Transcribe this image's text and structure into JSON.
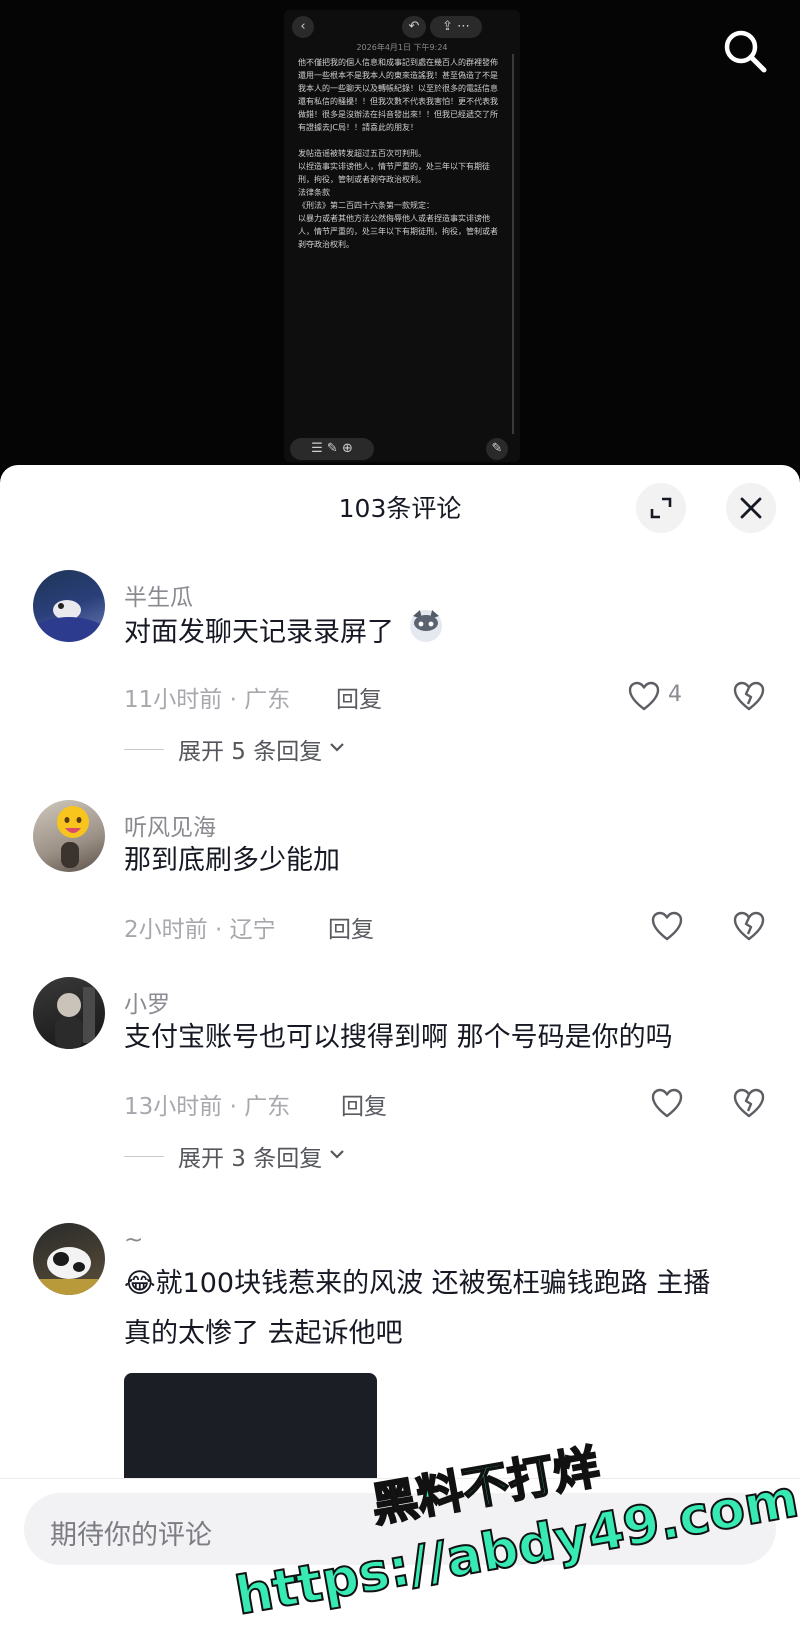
{
  "video": {
    "screenshot_date": "2026年4月1日 下午9:24",
    "screenshot_text": "他不僅把我的個人信息和成事記到處在幾百人的群裡發佈 還用一些根本不是我本人的東來造謠我！甚至偽造了不是我本人的一些聊天以及轉帳紀錄！以至於很多的電話信息還有私信的騷擾！！但我次數不代表我害怕！更不代表我做錯！很多是沒辦法在抖音發出來！！但我已經遞交了所有證據去JC局！！請喜此的朋友！\n\n发帖造谣被转发超过五百次可判刑。\n以捏造事实诽谤他人，情节严重的，处三年以下有期徒刑，拘役，管制或者剥夺政治权利。\n法律条款\n《刑法》第二百四十六条第一款规定：\n以暴力或者其他方法公然侮辱他人或者捏造事实诽谤他人，情节严重的，处三年以下有期徒刑，拘役，管制或者剥夺政治权利。"
  },
  "sheet": {
    "title": "103条评论"
  },
  "comments": [
    {
      "name": "半生瓜",
      "text": "对面发聊天记录录屏了",
      "time": "11小时前 · 广东",
      "reply": "回复",
      "likes": "4",
      "expand": "展开 5 条回复"
    },
    {
      "name": "听风见海",
      "text": "那到底刷多少能加",
      "time": "2小时前 · 辽宁",
      "reply": "回复",
      "likes": ""
    },
    {
      "name": "小罗",
      "text": "支付宝账号也可以搜得到啊  那个号码是你的吗",
      "time": "13小时前 · 广东",
      "reply": "回复",
      "likes": "",
      "expand": "展开 3 条回复"
    },
    {
      "name": "~",
      "text": "😂就100块钱惹来的风波 还被冤枉骗钱跑路 主播真的太惨了 去起诉他吧"
    }
  ],
  "input": {
    "placeholder": "期待你的评论"
  },
  "watermark": {
    "line1": "黑料不打烊",
    "line2": "https://abdy49.com"
  }
}
